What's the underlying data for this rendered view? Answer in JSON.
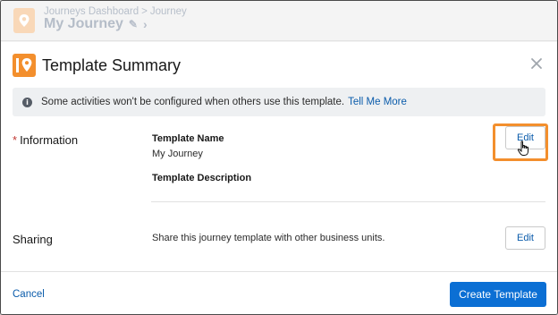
{
  "app_header": {
    "breadcrumb": [
      "Journeys Dashboard",
      "Journey"
    ],
    "breadcrumb_separator": ">",
    "journey_name": "My Journey",
    "icon": "location-pin-icon"
  },
  "modal": {
    "title": "Template Summary",
    "close_icon": "close-icon",
    "banner": {
      "text": "Some activities won't be configured when others use this template.",
      "link": "Tell Me More"
    },
    "information": {
      "label": "Information",
      "required_marker": "*",
      "template_name_label": "Template Name",
      "template_name_value": "My Journey",
      "template_description_label": "Template Description",
      "edit_label": "Edit"
    },
    "sharing": {
      "label": "Sharing",
      "text": "Share this journey template with other business units.",
      "edit_label": "Edit"
    },
    "footer": {
      "cancel_label": "Cancel",
      "create_label": "Create Template"
    }
  },
  "colors": {
    "accent_orange": "#f38f2d",
    "link_blue": "#0b5cab",
    "brand_blue": "#0b6fd4"
  }
}
